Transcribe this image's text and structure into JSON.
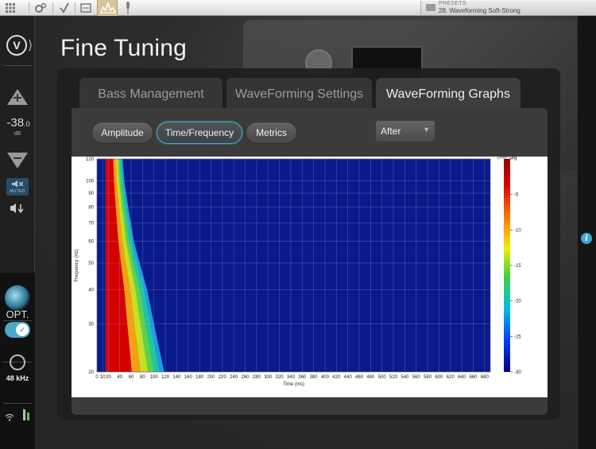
{
  "topbar": {
    "preset_label": "PRESETS",
    "preset_name": "28. Waveforming Soft-Strong"
  },
  "sidebar": {
    "volume_value": "-38",
    "volume_decimal": ".0",
    "volume_unit": "dB",
    "mute_text": "MUTED",
    "input_label": "OPT.",
    "sample_rate": "48 kHz"
  },
  "page": {
    "title": "Fine Tuning"
  },
  "tabs": [
    {
      "label": "Bass Management",
      "active": false
    },
    {
      "label": "WaveForming Settings",
      "active": false
    },
    {
      "label": "WaveForming Graphs",
      "active": true
    }
  ],
  "graph_buttons": [
    {
      "label": "Amplitude",
      "active": false
    },
    {
      "label": "Time/Frequency",
      "active": true
    },
    {
      "label": "Metrics",
      "active": false
    }
  ],
  "view_select": {
    "value": "After"
  },
  "colors": {
    "accent": "#4aa7c8",
    "plot_background": "#0a1a8c",
    "hot": "#d40000"
  },
  "chart_data": {
    "type": "heatmap",
    "xlabel": "Time (ms)",
    "ylabel": "Frequency (Hz)",
    "colorbar_label": "Level (dB)",
    "xlim": [
      0,
      690
    ],
    "ylim": [
      20,
      120
    ],
    "yscale": "log",
    "x_ticks": [
      0,
      10,
      20,
      40,
      60,
      80,
      100,
      120,
      140,
      160,
      180,
      200,
      220,
      240,
      260,
      280,
      300,
      320,
      340,
      360,
      380,
      400,
      420,
      440,
      460,
      480,
      500,
      520,
      540,
      560,
      580,
      600,
      620,
      640,
      660,
      680
    ],
    "y_ticks": [
      20,
      30,
      40,
      50,
      60,
      70,
      80,
      90,
      100,
      120
    ],
    "colorbar_ticks": [
      0,
      -5,
      -10,
      -15,
      -20,
      -25,
      -30
    ],
    "colorbar_range": [
      -30,
      0
    ],
    "grid": true,
    "decay_profile": [
      {
        "frequency_hz": 120,
        "decay_end_ms": 45
      },
      {
        "frequency_hz": 100,
        "decay_end_ms": 48
      },
      {
        "frequency_hz": 80,
        "decay_end_ms": 55
      },
      {
        "frequency_hz": 60,
        "decay_end_ms": 65
      },
      {
        "frequency_hz": 50,
        "decay_end_ms": 75
      },
      {
        "frequency_hz": 40,
        "decay_end_ms": 88
      },
      {
        "frequency_hz": 30,
        "decay_end_ms": 100
      },
      {
        "frequency_hz": 20,
        "decay_end_ms": 118
      }
    ]
  }
}
